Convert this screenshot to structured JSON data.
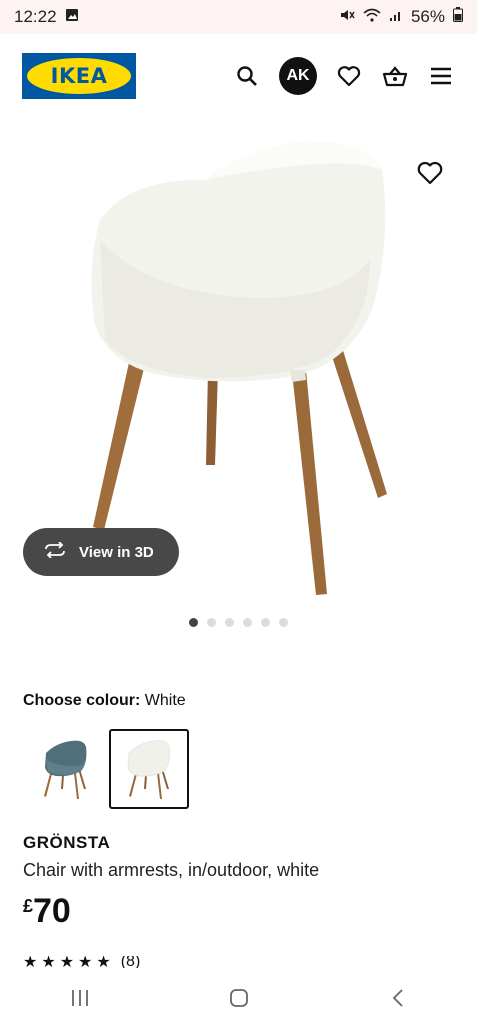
{
  "status_bar": {
    "time": "12:22",
    "battery": "56%"
  },
  "header": {
    "logo_text": "IKEA",
    "avatar_initials": "AK"
  },
  "gallery": {
    "view_3d_label": "View in 3D",
    "image_count": 6,
    "active_index": 0
  },
  "colour": {
    "label": "Choose colour:",
    "value": "White",
    "options": [
      "Blue",
      "White"
    ],
    "selected": "White"
  },
  "product": {
    "name": "GRÖNSTA",
    "description": "Chair with armrests, in/outdoor, white",
    "currency": "£",
    "price": "70",
    "rating_stars": 5,
    "review_count": "(8)"
  },
  "colors": {
    "ikea_blue": "#0058a3",
    "ikea_yellow": "#ffdb00",
    "wood": "#9b6a3a"
  }
}
